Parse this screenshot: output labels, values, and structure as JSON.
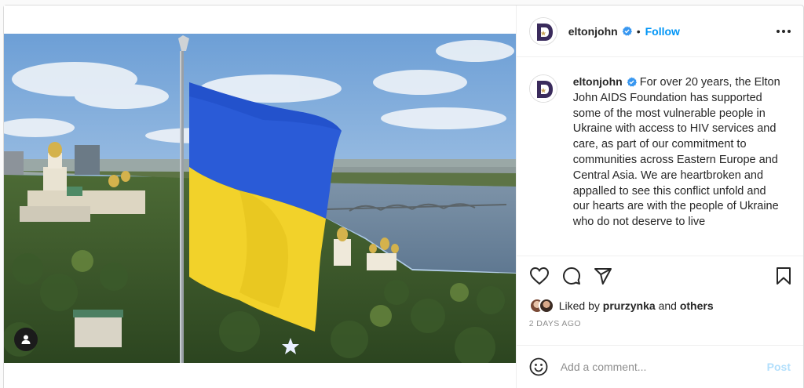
{
  "post": {
    "username": "eltonjohn",
    "follow_label": "Follow",
    "separator": "•",
    "caption_text": "For over 20 years, the Elton John AIDS Foundation has supported some of the most vulnerable people in Ukraine with access to HIV services and care, as part of our commitment to communities across Eastern Europe and Central Asia. We are heartbroken and appalled to see this conflict unfold and our hearts are with the people of Ukraine who do not deserve to live",
    "likes": {
      "prefix": "Liked by",
      "user": "prurzynka",
      "conj": "and",
      "others": "others"
    },
    "timestamp": "2 DAYS AGO",
    "comment": {
      "placeholder": "Add a comment...",
      "value": "",
      "post_label": "Post"
    }
  },
  "colors": {
    "accent": "#0095f6",
    "flag_blue": "#2a5bd7",
    "flag_yellow": "#f2d22a",
    "post_disabled": "#b2dffc"
  },
  "icons": [
    "verified-badge-icon",
    "more-options-icon",
    "heart-icon",
    "comment-icon",
    "share-icon",
    "bookmark-icon",
    "emoji-icon",
    "user-tag-icon"
  ]
}
